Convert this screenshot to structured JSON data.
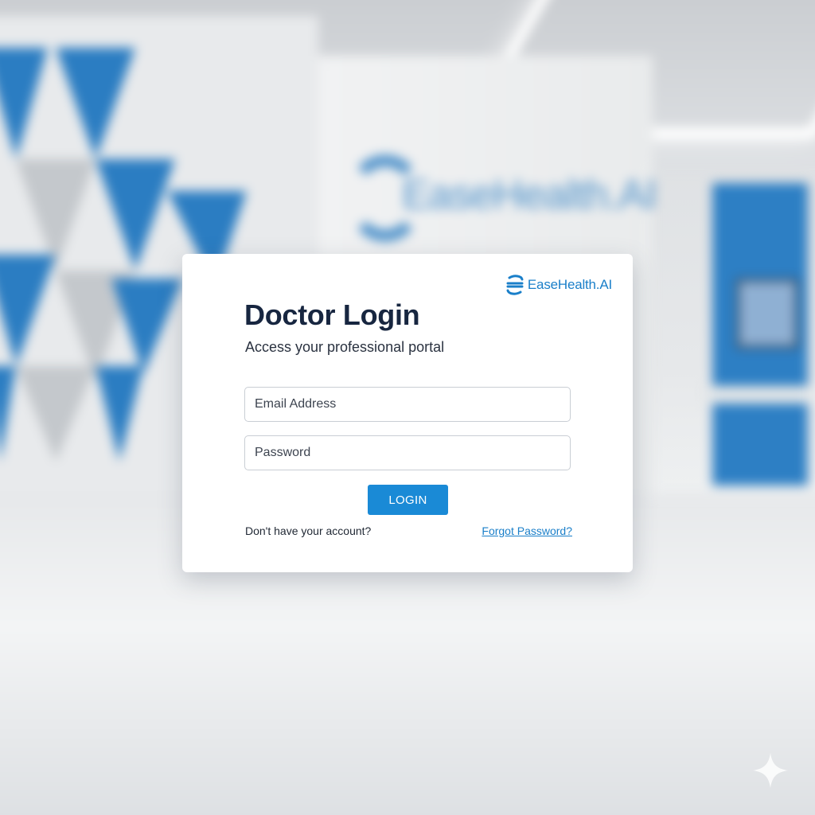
{
  "background": {
    "wall_logo_text": "EaseHealth.AI"
  },
  "brand": {
    "name": "EaseHealth.AI",
    "color": "#1a7fc9"
  },
  "login": {
    "title": "Doctor Login",
    "subtitle": "Access your professional portal",
    "email_placeholder": "Email Address",
    "password_placeholder": "Password",
    "button_label": "LOGIN",
    "no_account_text": "Don't have your account?",
    "forgot_password_link": "Forgot Password?"
  },
  "colors": {
    "accent": "#1a8ad6",
    "title_text": "#172640",
    "wall_blue": "#2d7fc4"
  },
  "icons": {
    "brand": "easehealth-logo-icon",
    "corner": "sparkle-icon"
  }
}
